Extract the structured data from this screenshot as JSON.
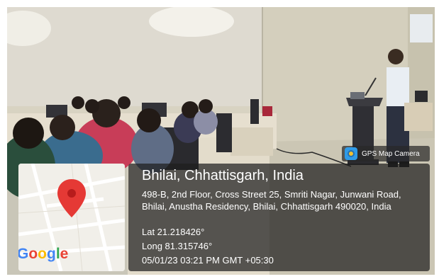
{
  "badge": {
    "text": "GPS Map Camera",
    "icon": "camera-app-icon"
  },
  "location": {
    "title": "Bhilai, Chhattisgarh, India",
    "address": "498-B, 2nd Floor, Cross Street 25, Smriti Nagar, Junwani Road, Bhilai, Anustha Residency, Bhilai, Chhattisgarh 490020, India",
    "lat": "Lat 21.218426°",
    "long": "Long 81.315746°",
    "datetime": "05/01/23 03:21 PM GMT +05:30"
  },
  "map": {
    "brand": [
      "G",
      "o",
      "o",
      "g",
      "l",
      "e"
    ],
    "pin_icon": "map-pin-icon",
    "pin_color": "#e53935"
  },
  "scene": {
    "description_icon": "classroom-photo"
  }
}
